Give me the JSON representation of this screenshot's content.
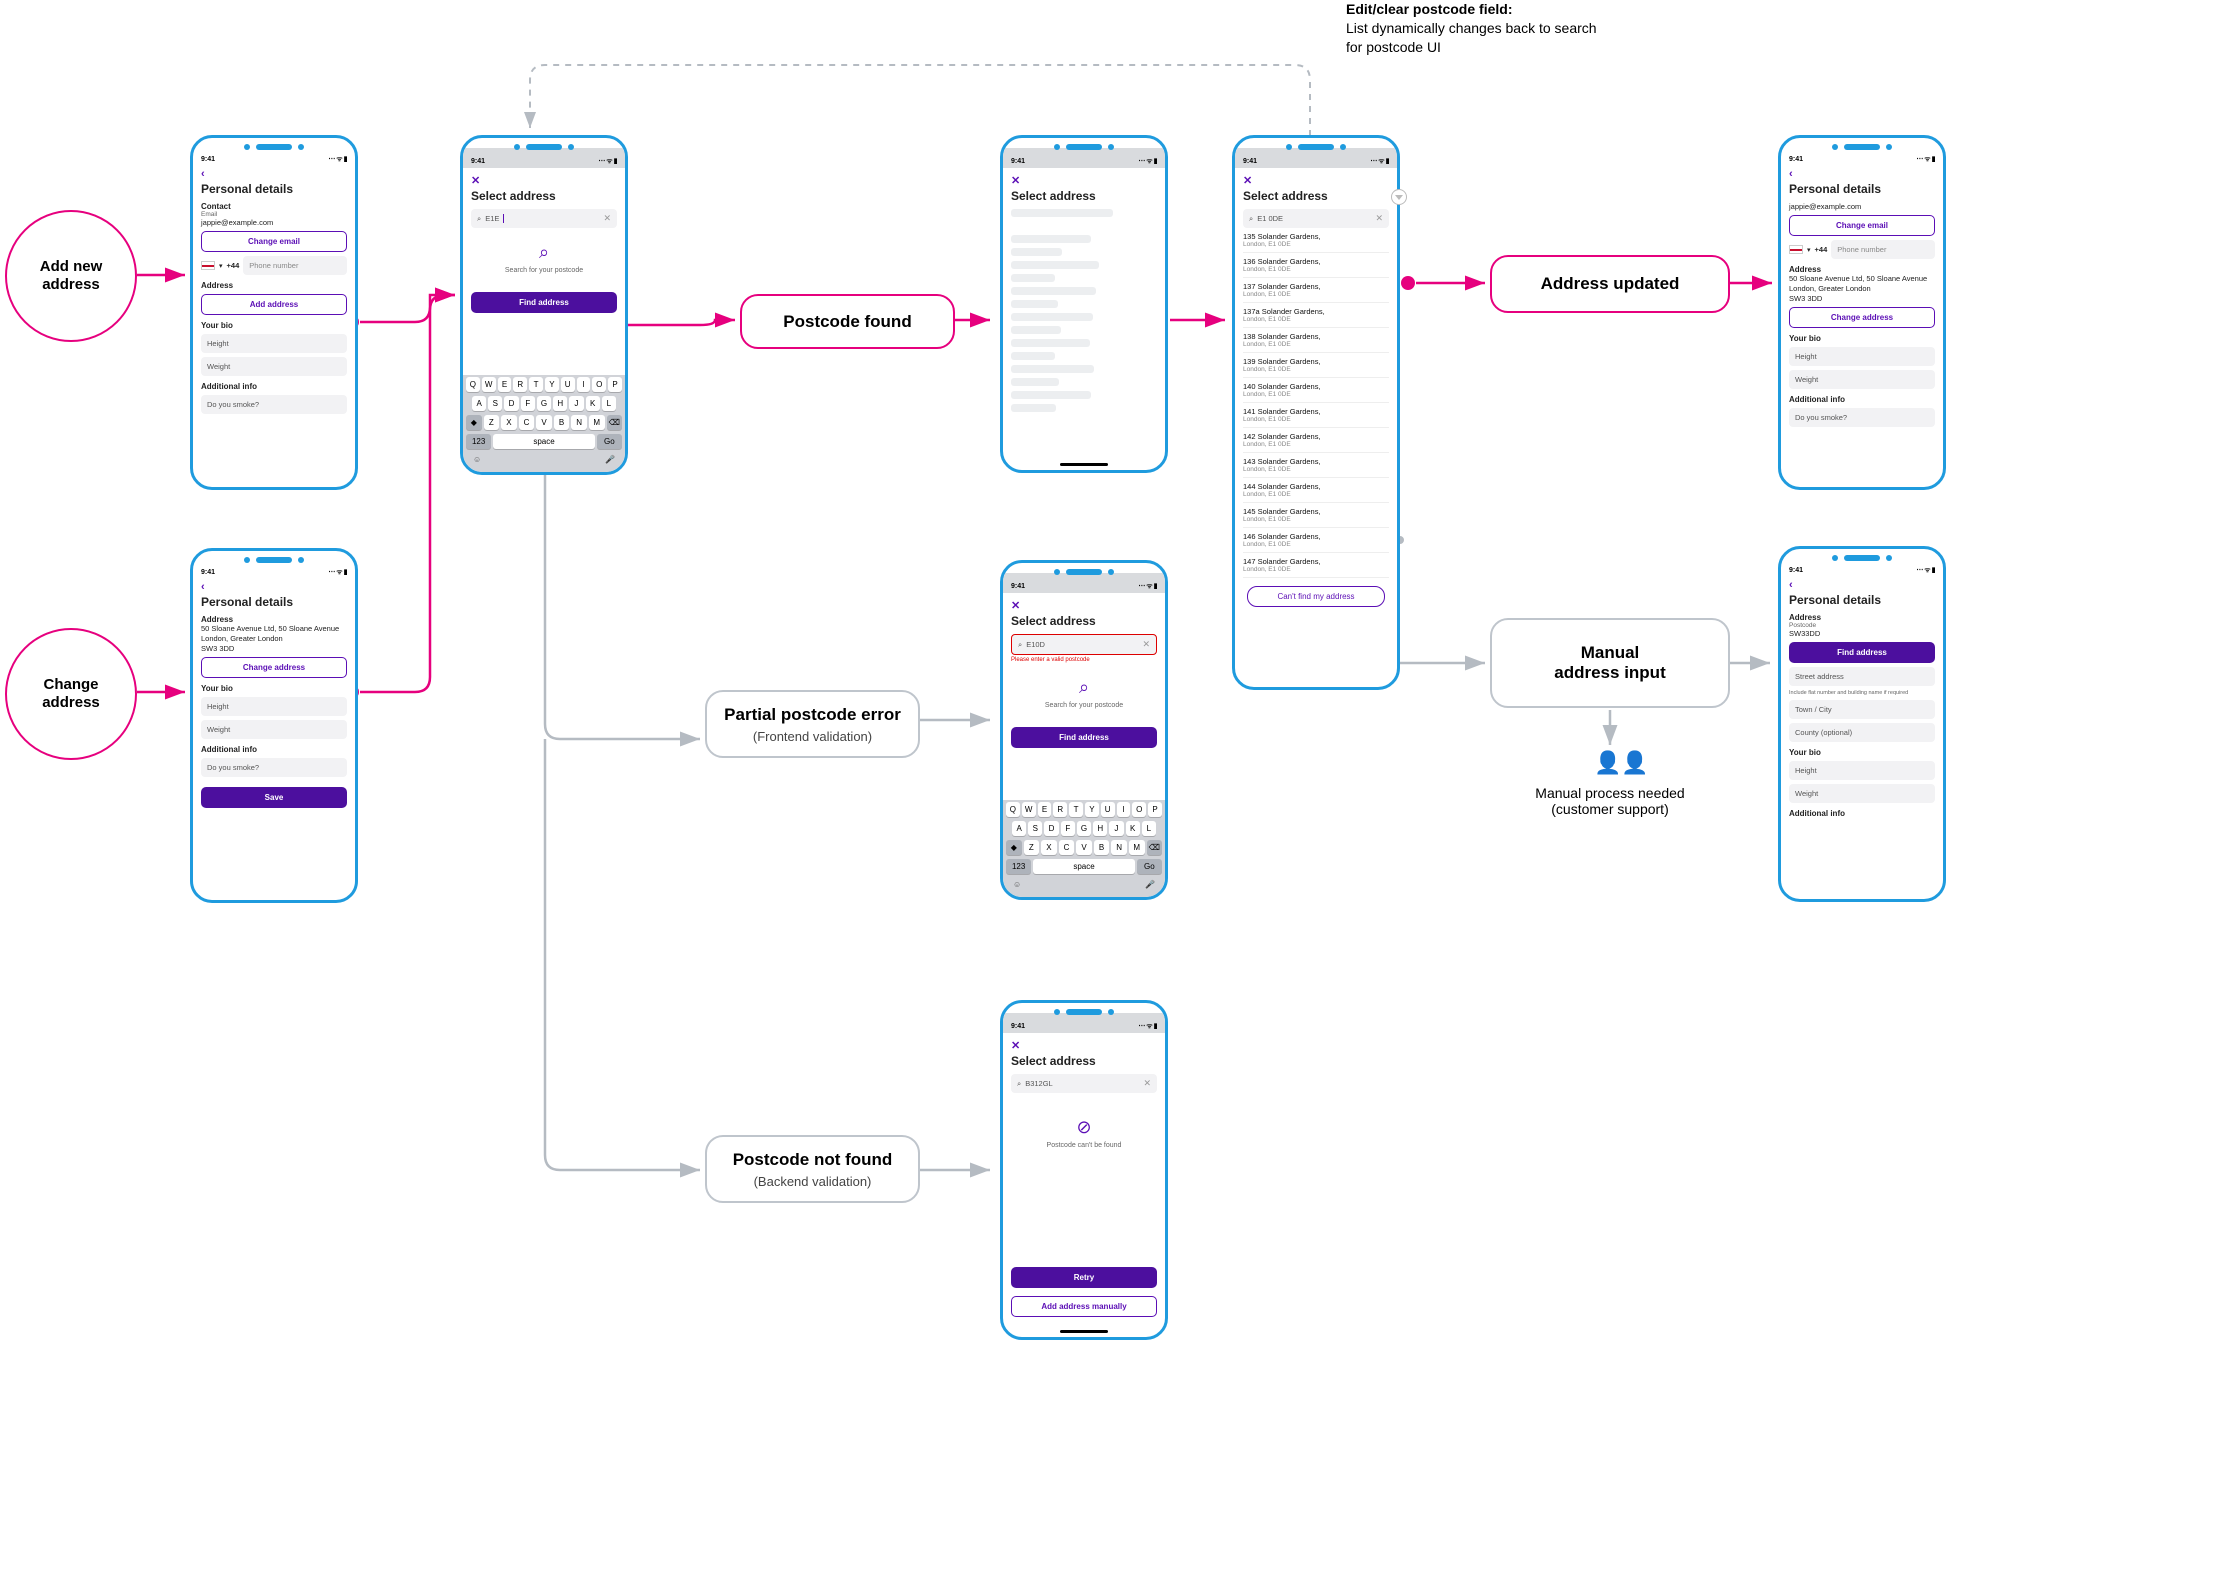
{
  "annotation": {
    "title": "Edit/clear postcode field:",
    "body": "List dynamically changes back to search for postcode UI"
  },
  "entries": {
    "add_new": "Add new\naddress",
    "change": "Change\naddress"
  },
  "nodes": {
    "postcode_found": "Postcode found",
    "partial_error_title": "Partial postcode error",
    "partial_error_sub": "(Frontend validation)",
    "not_found_title": "Postcode not found",
    "not_found_sub": "(Backend validation)",
    "address_updated": "Address updated",
    "manual_input": "Manual\naddress input"
  },
  "support": {
    "line1": "Manual process needed",
    "line2": "(customer support)"
  },
  "common": {
    "time": "9:41",
    "status_icons": "⋯ ᯤ ▮",
    "personal_details": "Personal details",
    "select_address": "Select address",
    "change_email": "Change email",
    "add_address": "Add address",
    "change_address": "Change address",
    "find_address": "Find address",
    "retry": "Retry",
    "add_manually": "Add address manually",
    "cant_find": "Can't find my address",
    "save": "Save",
    "your_bio": "Your bio",
    "height": "Height",
    "weight": "Weight",
    "additional": "Additional info",
    "smoke": "Do you smoke?",
    "contact": "Contact",
    "email_label": "Email",
    "email_value": "jappie@example.com",
    "country_code": "+44",
    "phone_placeholder": "Phone number",
    "address_label": "Address",
    "search_hint": "Search for your postcode",
    "error_text": "Please enter a valid postcode",
    "not_found_text": "Postcode can't be found",
    "postcode_label": "Postcode",
    "street_label": "Street address",
    "street_hint": "Include flat number and building name if required",
    "town_label": "Town / City",
    "county_label": "County (optional)"
  },
  "addresses": {
    "full": "50 Sloane Avenue Ltd, 50 Sloane Avenue London, Greater London\nSW3 3DD",
    "full_oneline": "50 Sloane Avenue Ltd, 50 Sloane Avenue London, Greater London",
    "full_post": "SW3 3DD"
  },
  "searches": {
    "typing": "E1E",
    "found": "E1 0DE",
    "partial": "E10D",
    "notfound": "B312GL",
    "manual_postcode": "SW33DD"
  },
  "list": {
    "city": "London, E1 0DE",
    "items": [
      "135 Solander Gardens,",
      "136 Solander Gardens,",
      "137 Solander Gardens,",
      "137a Solander Gardens,",
      "138 Solander Gardens,",
      "139 Solander Gardens,",
      "140 Solander Gardens,",
      "141 Solander Gardens,",
      "142 Solander Gardens,",
      "143 Solander Gardens,",
      "144 Solander Gardens,",
      "145 Solander Gardens,",
      "146 Solander Gardens,",
      "147 Solander Gardens,"
    ]
  },
  "keyboard": {
    "row1": [
      "Q",
      "W",
      "E",
      "R",
      "T",
      "Y",
      "U",
      "I",
      "O",
      "P"
    ],
    "row2": [
      "A",
      "S",
      "D",
      "F",
      "G",
      "H",
      "J",
      "K",
      "L"
    ],
    "row3": [
      "◆",
      "Z",
      "X",
      "C",
      "V",
      "B",
      "N",
      "M",
      "⌫"
    ],
    "num": "123",
    "space": "space",
    "go": "Go"
  }
}
